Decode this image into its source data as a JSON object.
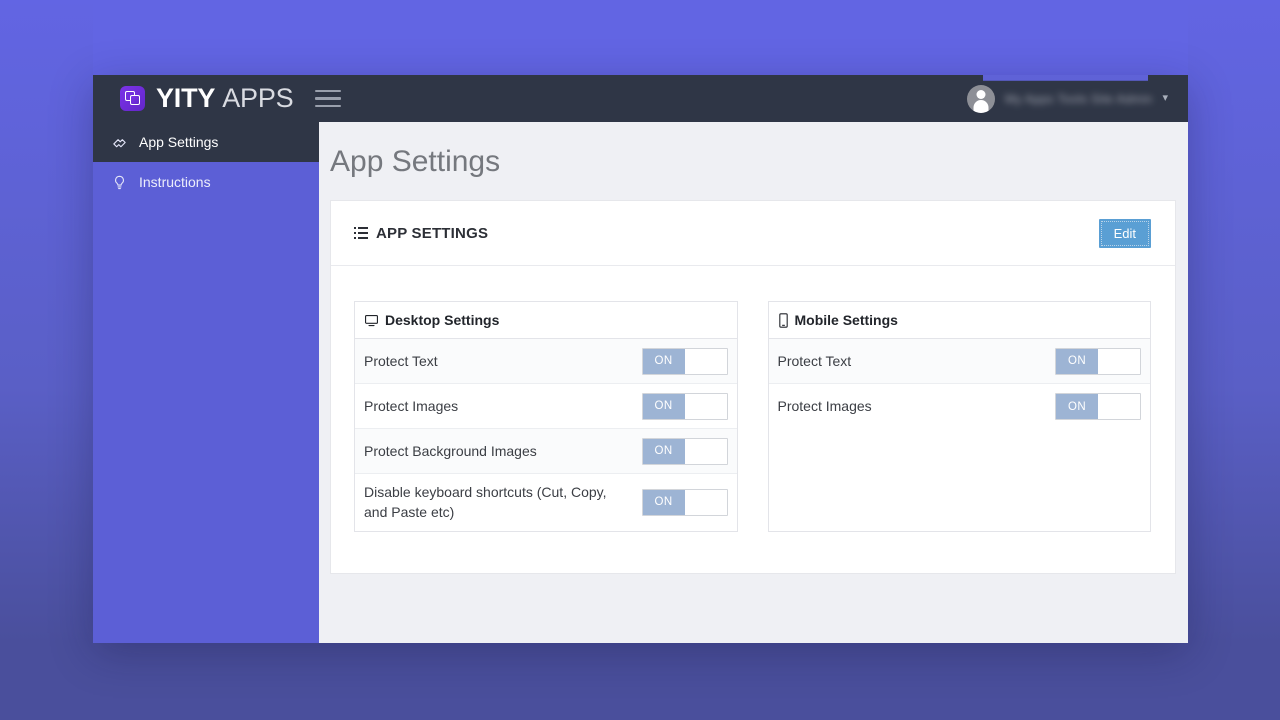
{
  "brand": {
    "strong": "YITY",
    "light": "APPS",
    "logo_icon": "overlapping-squares-icon",
    "menu_icon": "hamburger-icon"
  },
  "navbar": {
    "avatar_icon": "user-avatar-icon",
    "user_menu_label": "My Apps Tools Site Admin",
    "caret_icon": "chevron-down-icon"
  },
  "sidebar": {
    "items": [
      {
        "label": "App Settings",
        "icon": "puzzle-icon",
        "active": true
      },
      {
        "label": "Instructions",
        "icon": "lightbulb-icon",
        "active": false
      }
    ]
  },
  "main": {
    "page_title": "App Settings",
    "card": {
      "header_icon": "list-icon",
      "header_title": "APP SETTINGS",
      "edit_label": "Edit"
    },
    "panels": [
      {
        "icon": "desktop-icon",
        "title": "Desktop Settings",
        "rows": [
          {
            "label": "Protect Text",
            "toggle": "ON",
            "state": true
          },
          {
            "label": "Protect Images",
            "toggle": "ON",
            "state": true
          },
          {
            "label": "Protect Background Images",
            "toggle": "ON",
            "state": true
          },
          {
            "label": "Disable keyboard shortcuts (Cut, Copy, and Paste etc)",
            "toggle": "ON",
            "state": true
          }
        ]
      },
      {
        "icon": "mobile-icon",
        "title": "Mobile Settings",
        "rows": [
          {
            "label": "Protect Text",
            "toggle": "ON",
            "state": true
          },
          {
            "label": "Protect Images",
            "toggle": "ON",
            "state": true
          }
        ]
      }
    ]
  },
  "colors": {
    "backdrop": "#6265e3",
    "backdrop_bottom": "#4a4f9c",
    "navbar": "#2f3646",
    "sidebar": "#5c5fd6",
    "sidebar_active": "#2f3646",
    "accent_button": "#5a9fd4",
    "toggle_on": "#9db4d4",
    "logo": "#6d2fdd",
    "content_bg": "#eff0f4"
  }
}
